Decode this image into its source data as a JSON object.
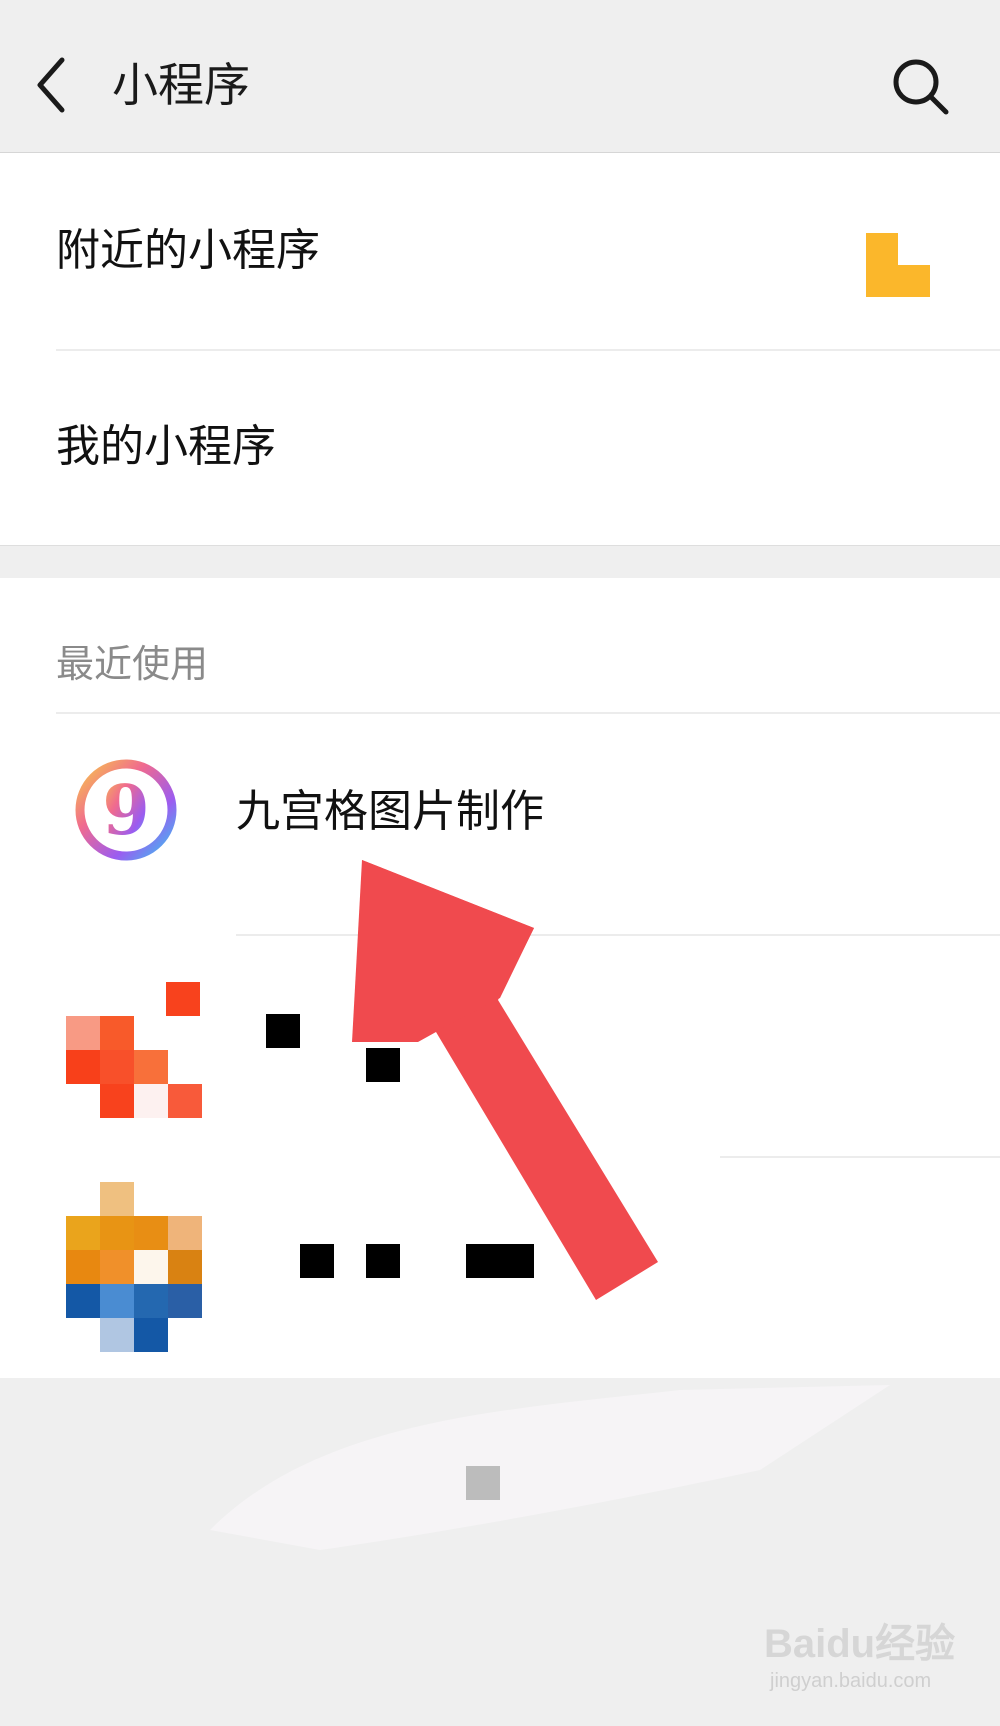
{
  "header": {
    "title": "小程序",
    "back_icon": "chevron-left-icon",
    "search_icon": "search-icon"
  },
  "menu": {
    "nearby_label": "附近的小程序",
    "nearby_icon": "location-icon",
    "mine_label": "我的小程序"
  },
  "recent": {
    "header": "最近使用",
    "items": [
      {
        "title": "九宫格图片制作",
        "icon": "nine-grid-app-icon"
      },
      {
        "title": "",
        "icon": "pixelated-app-icon"
      },
      {
        "title": "",
        "icon": "pixelated-app-icon"
      }
    ]
  },
  "watermark": {
    "brand": "Baidu经验",
    "url": "jingyan.baidu.com"
  },
  "colors": {
    "arrow": "#f04a4e",
    "accent_yellow": "#fbb72b",
    "background": "#efefef"
  }
}
